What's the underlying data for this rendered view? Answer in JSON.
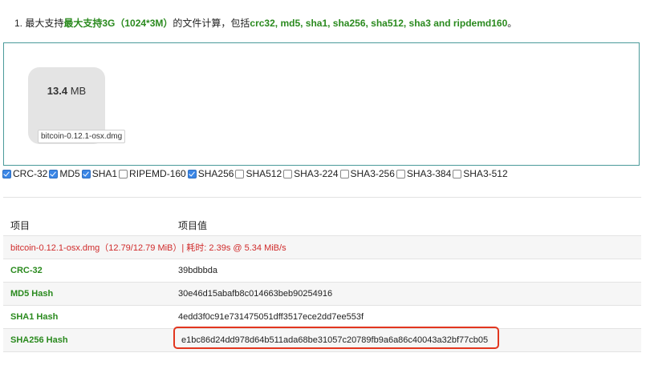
{
  "intro": {
    "prefix": "1. 最大支持",
    "highlight": "最大支持3G（1024*3M）",
    "middle": "的文件计算，包括",
    "algos": "crc32, md5, sha1, sha256, sha512, sha3 and ripdemd160",
    "suffix": "。"
  },
  "file": {
    "size_value": "13.4",
    "size_unit": "MB",
    "name": "bitcoin-0.12.1-osx.dmg"
  },
  "algorithms": [
    {
      "label": "CRC-32",
      "checked": true
    },
    {
      "label": "MD5",
      "checked": true
    },
    {
      "label": "SHA1",
      "checked": true
    },
    {
      "label": "RIPEMD-160",
      "checked": false
    },
    {
      "label": "SHA256",
      "checked": true
    },
    {
      "label": "SHA512",
      "checked": false
    },
    {
      "label": "SHA3-224",
      "checked": false
    },
    {
      "label": "SHA3-256",
      "checked": false
    },
    {
      "label": "SHA3-384",
      "checked": false
    },
    {
      "label": "SHA3-512",
      "checked": false
    }
  ],
  "table": {
    "header": {
      "col1": "项目",
      "col2": "项目值"
    },
    "summary": "bitcoin-0.12.1-osx.dmg（12.79/12.79 MiB）| 耗时: 2.39s @ 5.34 MiB/s",
    "rows": [
      {
        "label": "CRC-32",
        "value": "39bdbbda"
      },
      {
        "label": "MD5 Hash",
        "value": "30e46d15abafb8c014663beb90254916"
      },
      {
        "label": "SHA1 Hash",
        "value": "4edd3f0c91e731475051dff3517ece2dd7ee553f"
      },
      {
        "label": "SHA256 Hash",
        "value": "e1bc86d24dd978d64b511ada68be31057c20789fb9a6a86c40043a32bf77cb05"
      }
    ]
  },
  "colors": {
    "accent_green": "#2a8a1e",
    "summary_red": "#d02b2b",
    "highlight_border": "#e2361f",
    "checkbox_blue": "#3a86e6"
  }
}
